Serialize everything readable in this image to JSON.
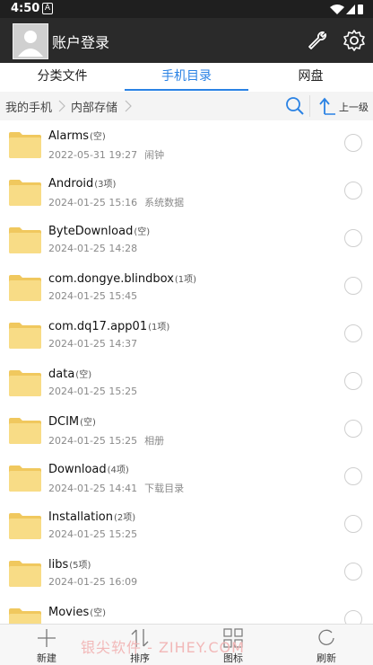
{
  "status": {
    "time": "4:50",
    "notification_icon": "A"
  },
  "header": {
    "title": "账户登录",
    "avatar": "avatar-placeholder",
    "tools_icon": "wrench-icon",
    "settings_icon": "gear-icon"
  },
  "tabs": [
    {
      "label": "分类文件",
      "active": false
    },
    {
      "label": "手机目录",
      "active": true
    },
    {
      "label": "网盘",
      "active": false
    }
  ],
  "path": {
    "root": "我的手机",
    "current": "内部存储",
    "up_label": "上一级"
  },
  "files": [
    {
      "name": "Alarms",
      "count": "(空)",
      "date": "2022-05-31 19:27",
      "note": "闹钟"
    },
    {
      "name": "Android",
      "count": "(3项)",
      "date": "2024-01-25 15:16",
      "note": "系统数据"
    },
    {
      "name": "ByteDownload",
      "count": "(空)",
      "date": "2024-01-25 14:28",
      "note": ""
    },
    {
      "name": "com.dongye.blindbox",
      "count": "(1项)",
      "date": "2024-01-25 15:45",
      "note": ""
    },
    {
      "name": "com.dq17.app01",
      "count": "(1项)",
      "date": "2024-01-25 14:37",
      "note": ""
    },
    {
      "name": "data",
      "count": "(空)",
      "date": "2024-01-25 15:25",
      "note": ""
    },
    {
      "name": "DCIM",
      "count": "(空)",
      "date": "2024-01-25 15:25",
      "note": "相册"
    },
    {
      "name": "Download",
      "count": "(4项)",
      "date": "2024-01-25 14:41",
      "note": "下载目录"
    },
    {
      "name": "Installation",
      "count": "(2项)",
      "date": "2024-01-25 15:25",
      "note": ""
    },
    {
      "name": "libs",
      "count": "(5项)",
      "date": "2024-01-25 16:09",
      "note": ""
    },
    {
      "name": "Movies",
      "count": "(空)",
      "date": "",
      "note": ""
    }
  ],
  "bottom": [
    {
      "label": "新建",
      "icon": "plus-icon"
    },
    {
      "label": "排序",
      "icon": "sort-icon"
    },
    {
      "label": "图标",
      "icon": "grid-icon"
    },
    {
      "label": "刷新",
      "icon": "refresh-icon"
    }
  ],
  "watermark": "银尖软件 - ZIHEY.COM",
  "colors": {
    "accent": "#2a82e4",
    "folder": "#f7d77a",
    "appbar": "#2a2a2a"
  }
}
